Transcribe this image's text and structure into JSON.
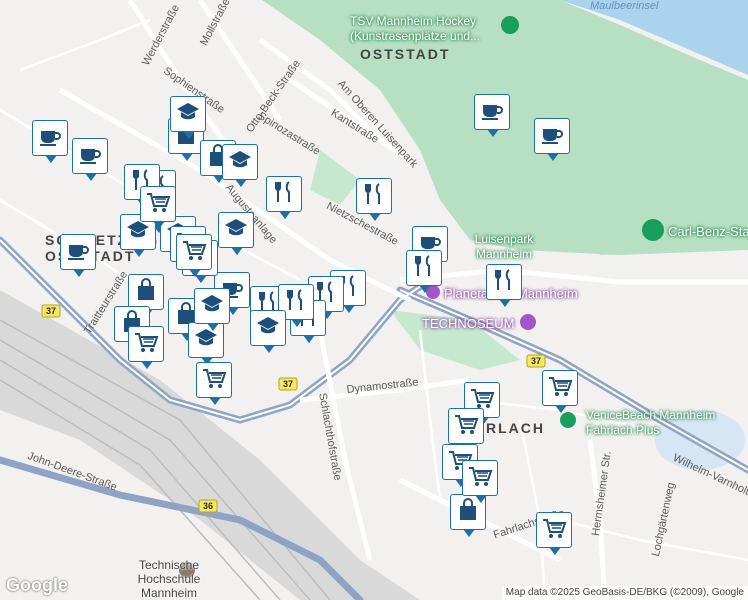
{
  "map": {
    "attribution": "Map data ©2025 GeoBasis-DE/BKG (©2009), Google",
    "logo": "Google",
    "colors": {
      "background": "#f2f1ef",
      "park": "#b7e0c3",
      "water": "#aad3ee",
      "rail": "#c9c9c9",
      "highway": "#8fa4c5",
      "marker_border": "#1e6fa6"
    },
    "district_labels": [
      "OSTSTADT",
      "SCHWETZINGER OSTSTADT",
      "FAHRLACH"
    ],
    "street_labels": [
      "Werderstraße",
      "Mollstraße",
      "Sophienstraße",
      "Otto-Beck-Straße",
      "Spinozastraße",
      "Kantstraße",
      "Am Oberen Luisenpark",
      "Nietzschestraße",
      "Augustaanlage",
      "Traitteurstraße",
      "Dynamostraße",
      "Schlachthofstraße",
      "Fahrlachstraße",
      "Hermsheimer Str.",
      "Lochgärtenweg",
      "John-Deere-Straße",
      "Wilhelm-Varnholt-Allee",
      "Maulbeerinsel"
    ],
    "poi_labels": [
      "TSV Mannheim Hockey (Kunstrasenplätze und...",
      "Luisenpark Mannheim",
      "Carl-Benz-Stadion",
      "Planetarium Mannheim",
      "TECHNOSEUM",
      "VeniceBeach Mannheim Fahrlach Plus",
      "Technische Hochschule Mannheim"
    ],
    "route_shields": [
      "37",
      "37",
      "37",
      "36"
    ],
    "markers": {
      "cafe": 7,
      "restaurant": 11,
      "shopping": 8,
      "school": 8,
      "grocery": 11
    }
  }
}
